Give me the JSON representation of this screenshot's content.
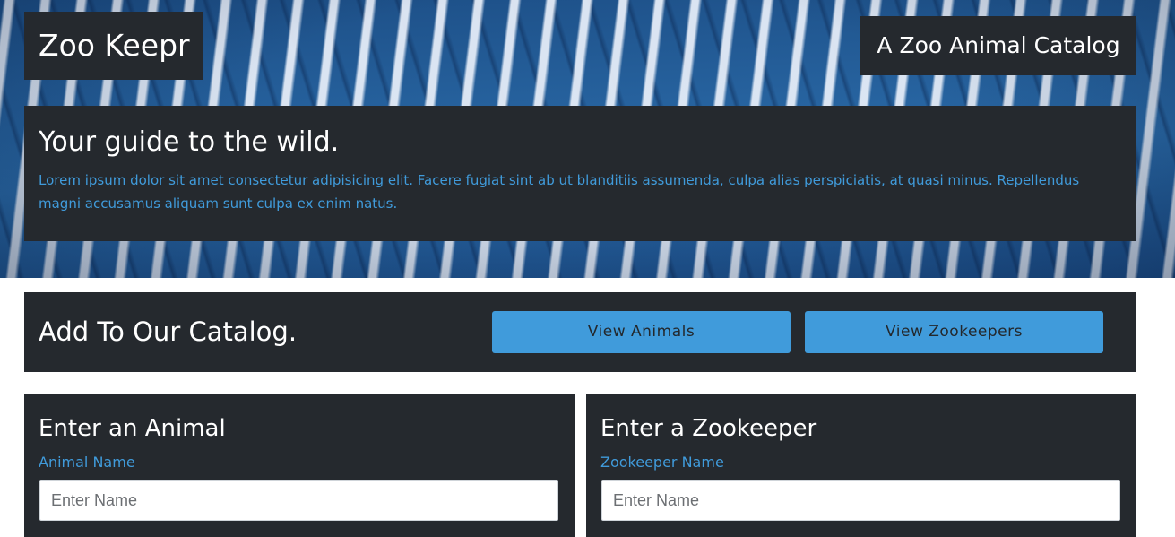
{
  "header": {
    "brand": "Zoo Keepr",
    "tagline": "A Zoo Animal Catalog"
  },
  "intro": {
    "heading": "Your guide to the wild.",
    "body": "Lorem ipsum dolor sit amet consectetur adipisicing elit. Facere fugiat sint ab ut blanditiis assumenda, culpa alias perspiciatis, at quasi minus. Repellendus magni accusamus aliquam sunt culpa ex enim natus."
  },
  "catalog": {
    "heading": "Add To Our Catalog.",
    "view_animals_label": "View Animals",
    "view_zookeepers_label": "View Zookeepers"
  },
  "animal_form": {
    "heading": "Enter an Animal",
    "name_label": "Animal Name",
    "name_placeholder": "Enter Name",
    "name_value": ""
  },
  "zookeeper_form": {
    "heading": "Enter a Zookeeper",
    "name_label": "Zookeeper Name",
    "name_placeholder": "Enter Name",
    "name_value": ""
  },
  "colors": {
    "panel": "#25292e",
    "accent": "#409bdb",
    "hero_blue": "#1d4f86"
  },
  "hero_image": "zebra-stripe-pattern"
}
